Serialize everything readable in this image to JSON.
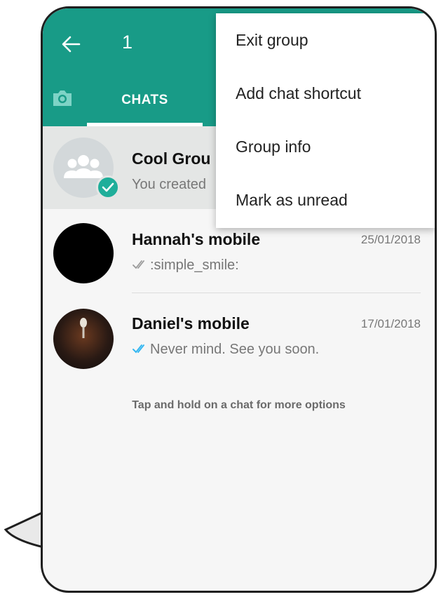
{
  "colors": {
    "accent": "#189b87",
    "check_badge": "#1fae9a",
    "read_ticks": "#34b7f1",
    "delivered_ticks": "#9a9a9a"
  },
  "header": {
    "back_icon": "arrow-left-icon",
    "selected_count": "1",
    "camera_icon": "camera-icon",
    "tabs": [
      {
        "label": "CHATS",
        "active": true
      }
    ]
  },
  "menu": {
    "items": [
      {
        "label": "Exit group"
      },
      {
        "label": "Add chat shortcut"
      },
      {
        "label": "Group info"
      },
      {
        "label": "Mark as unread"
      }
    ]
  },
  "chats": [
    {
      "name": "Cool Grou",
      "preview": "You created",
      "date": "",
      "selected": true,
      "avatar_icon": "group-icon",
      "badge_icon": "check-icon"
    },
    {
      "name": "Hannah's mobile",
      "preview": ":simple_smile:",
      "date": "25/01/2018",
      "ticks": "delivered"
    },
    {
      "name": "Daniel's mobile",
      "preview": "Never mind. See you soon.",
      "date": "17/01/2018",
      "ticks": "read"
    }
  ],
  "hint": "Tap and hold on a chat for more options"
}
